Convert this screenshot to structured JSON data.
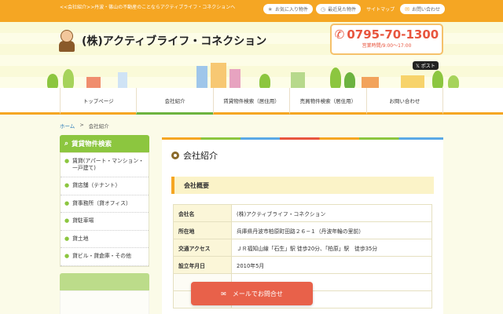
{
  "topbar": {
    "tagline": "<<会社紹介>>丹波・篠山の不動産のことならアクティブライフ・コネクションへ",
    "favorites": "お気に入り物件",
    "recent": "最近見た物件",
    "sitemap": "サイトマップ",
    "contact": "お問い合わせ"
  },
  "header": {
    "site_name": "(株)アクティブライフ・コネクション",
    "phone": "0795-70-1300",
    "hours": "営業時間/9:00〜17:00",
    "post": "ポスト"
  },
  "nav": [
    {
      "label": "トップページ"
    },
    {
      "label": "会社紹介"
    },
    {
      "label": "賃貸物件検索（居住用）"
    },
    {
      "label": "売買物件検索（居住用）"
    },
    {
      "label": "お問い合わせ"
    }
  ],
  "breadcrumb": {
    "home": "ホーム",
    "sep": ">",
    "current": "会社紹介"
  },
  "sidebar": {
    "title": "賃貸物件検索",
    "items": [
      {
        "label": "賃貸(アパート・マンション・一戸建て)"
      },
      {
        "label": "貸店舗（テナント）"
      },
      {
        "label": "貸事務所（貸オフィス）"
      },
      {
        "label": "貸駐車場"
      },
      {
        "label": "貸土地"
      },
      {
        "label": "貸ビル・貸倉庫・その他"
      }
    ]
  },
  "main": {
    "title": "会社紹介",
    "section": "会社概要",
    "rows": [
      {
        "label": "会社名",
        "value": "(株)アクティブライフ・コネクション"
      },
      {
        "label": "所在地",
        "value": "兵庫県丹波市柏原町田路２６−１（丹波年輪の里前）"
      },
      {
        "label": "交通アクセス",
        "value": "ＪＲ福知山線「石生」駅 徒歩20分、「柏原」駅　徒歩35分"
      },
      {
        "label": "設立年月日",
        "value": "2010年5月"
      }
    ]
  },
  "cta": {
    "label": "メールでお問合せ"
  },
  "colors": {
    "accent": "#f5a623",
    "green": "#8cc63f",
    "red": "#e8553e"
  }
}
